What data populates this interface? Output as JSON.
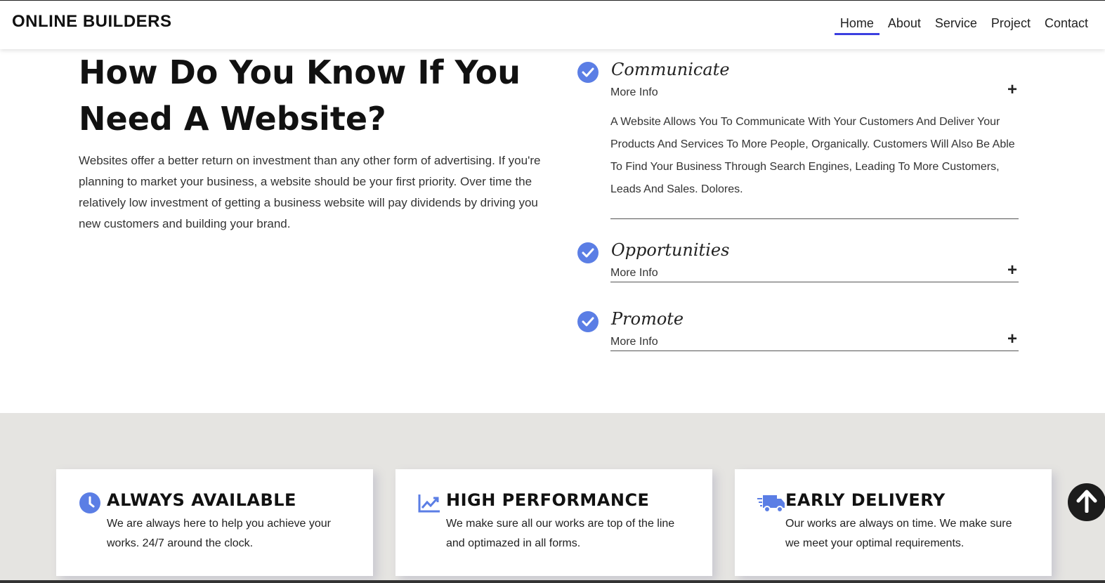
{
  "header": {
    "brand": "ONLINE BUILDERS",
    "nav": [
      {
        "label": "Home",
        "active": true
      },
      {
        "label": "About"
      },
      {
        "label": "Service"
      },
      {
        "label": "Project"
      },
      {
        "label": "Contact"
      }
    ]
  },
  "main": {
    "heading": "How Do You Know If You Need A Website?",
    "intro": "Websites offer a better return on investment than any other form of advertising. If you're planning to market your business, a website should be your first priority. Over time the relatively low investment of getting a business website will pay dividends by driving you new customers and building your brand."
  },
  "accordion": [
    {
      "title": "Communicate",
      "more": "More Info",
      "expanded": true,
      "body": "A Website Allows You To Communicate With Your Customers And Deliver Your Products And Services To More People, Organically. Customers Will Also Be Able To Find Your Business Through Search Engines, Leading To More Customers, Leads And Sales. Dolores."
    },
    {
      "title": "Opportunities",
      "more": "More Info",
      "expanded": false
    },
    {
      "title": "Promote",
      "more": "More Info",
      "expanded": false
    }
  ],
  "features": [
    {
      "icon": "clock-icon",
      "title": "ALWAYS AVAILABLE",
      "text": "We are always here to help you achieve your works. 24/7 around the clock."
    },
    {
      "icon": "chart-line-icon",
      "title": "HIGH PERFORMANCE",
      "text": "We make sure all our works are top of the line and optimazed in all forms."
    },
    {
      "icon": "truck-icon",
      "title": "EARLY DELIVERY",
      "text": "Our works are always on time. We make sure we meet your optimal requirements."
    }
  ],
  "colors": {
    "accent": "#5b7ee5",
    "nav_active": "#3b3fe0",
    "features_bg": "#e5e4e1"
  },
  "back_to_top_icon": "arrow-up-icon"
}
